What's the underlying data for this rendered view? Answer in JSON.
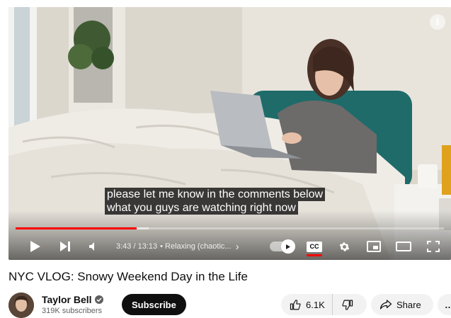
{
  "player": {
    "captions": [
      "please let me know in the comments below",
      "what you guys are watching right now"
    ],
    "current_time": "3:43",
    "duration": "13:13",
    "time_separator": "/",
    "chapter_title": "• Relaxing (chaotic...",
    "chapter_chevron": "›",
    "progress_played": 0.283,
    "progress_loaded": 0.31,
    "info_label": "i",
    "cc_label": "CC",
    "accent_color": "#ff0000",
    "icons": [
      "play-icon",
      "next-icon",
      "volume-icon",
      "autoplay-toggle-icon",
      "captions-icon",
      "settings-icon",
      "miniplayer-icon",
      "theater-icon",
      "fullscreen-icon"
    ]
  },
  "video": {
    "title": "NYC VLOG: Snowy Weekend Day in the Life"
  },
  "channel": {
    "name": "Taylor Bell",
    "subscribers": "319K subscribers",
    "subscribe_label": "Subscribe"
  },
  "actions": {
    "likes": "6.1K",
    "share_label": "Share",
    "more_label": "…"
  }
}
